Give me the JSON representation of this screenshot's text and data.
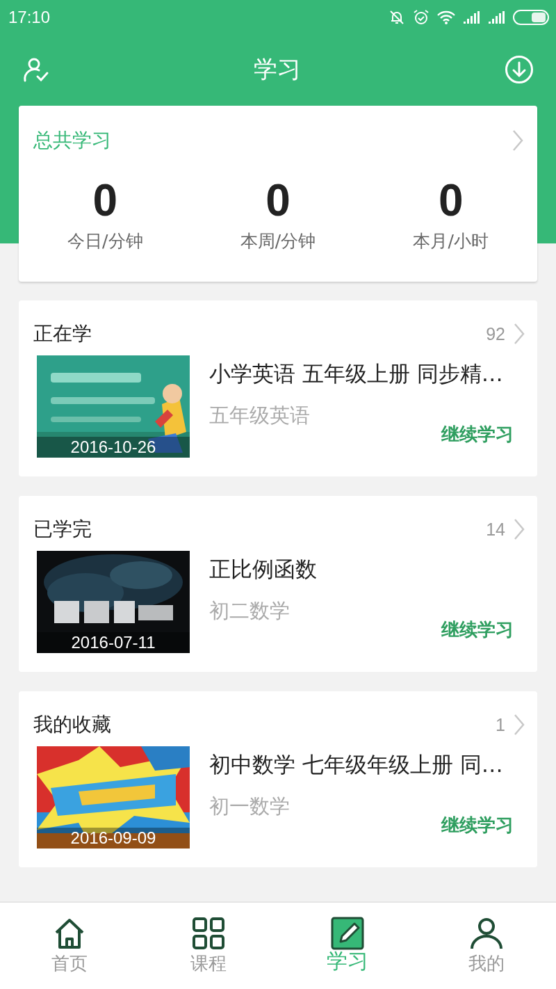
{
  "status_bar": {
    "time": "17:10"
  },
  "header": {
    "title": "学习"
  },
  "summary": {
    "title": "总共学习",
    "stats": [
      {
        "value": "0",
        "label": "今日/分钟"
      },
      {
        "value": "0",
        "label": "本周/分钟"
      },
      {
        "value": "0",
        "label": "本月/小时"
      }
    ]
  },
  "sections": [
    {
      "title": "正在学",
      "count": "92",
      "course": {
        "kind": "picture",
        "date": "2016-10-26",
        "title": "小学英语 五年级上册 同步精…",
        "subtitle": "五年级英语",
        "action": "继续学习"
      }
    },
    {
      "title": "已学完",
      "count": "14",
      "course": {
        "kind": "picture",
        "date": "2016-07-11",
        "title": "正比例函数",
        "subtitle": "初二数学",
        "action": "继续学习"
      }
    },
    {
      "title": "我的收藏",
      "count": "1",
      "course": {
        "kind": "picture",
        "date": "2016-09-09",
        "title": "初中数学 七年级年级上册 同…",
        "subtitle": "初一数学",
        "action": "继续学习"
      }
    }
  ],
  "bottom_nav": [
    {
      "label": "首页",
      "kind": "home",
      "selected": false
    },
    {
      "label": "课程",
      "kind": "grid",
      "selected": false
    },
    {
      "label": "学习",
      "kind": "pencil",
      "selected": true
    },
    {
      "label": "我的",
      "kind": "person",
      "selected": false
    }
  ]
}
